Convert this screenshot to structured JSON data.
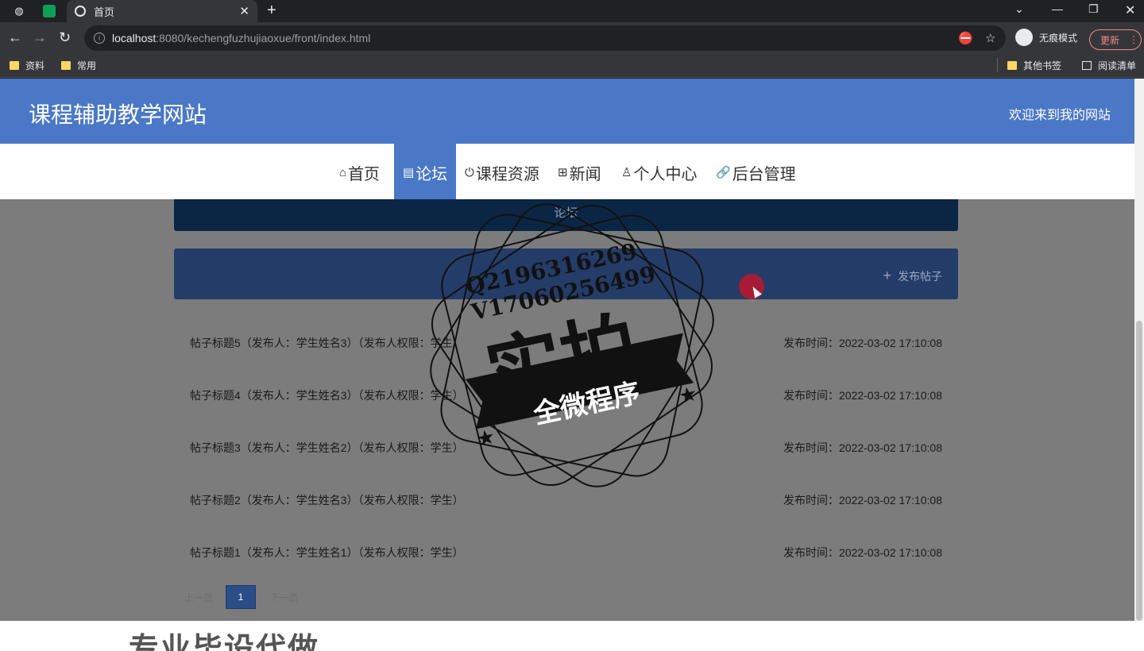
{
  "browser": {
    "tab_title": "首页",
    "url_host": "localhost",
    "url_rest": ":8080/kechengfuzhujiaoxue/front/index.html",
    "incognito_label": "无痕模式",
    "update_label": "更新",
    "bookmarks": [
      {
        "label": "资料"
      },
      {
        "label": "常用"
      }
    ],
    "other_bookmarks": "其他书签",
    "reading_list": "阅读清单"
  },
  "site": {
    "title": "课程辅助教学网站",
    "welcome": "欢迎来到我的网站",
    "nav": [
      {
        "icon": "⌂",
        "label": "首页"
      },
      {
        "icon": "▤",
        "label": "论坛"
      },
      {
        "icon": "⏻",
        "label": "课程资源"
      },
      {
        "icon": "⊞",
        "label": "新闻"
      },
      {
        "icon": "♙",
        "label": "个人中心"
      },
      {
        "icon": "🔗",
        "label": "后台管理"
      }
    ],
    "breadcrumb": "论坛",
    "post_button": "发布帖子",
    "posts": [
      {
        "title": "帖子标题5（发布人：学生姓名3）（发布人权限：学生）",
        "time": "发布时间：2022-03-02 17:10:08"
      },
      {
        "title": "帖子标题4（发布人：学生姓名3）（发布人权限：学生）",
        "time": "发布时间：2022-03-02 17:10:08"
      },
      {
        "title": "帖子标题3（发布人：学生姓名2）（发布人权限：学生）",
        "time": "发布时间：2022-03-02 17:10:08"
      },
      {
        "title": "帖子标题2（发布人：学生姓名3）（发布人权限：学生）",
        "time": "发布时间：2022-03-02 17:10:08"
      },
      {
        "title": "帖子标题1（发布人：学生姓名1）（发布人权限：学生）",
        "time": "发布时间：2022-03-02 17:10:08"
      }
    ],
    "pager": {
      "prev": "上一页",
      "current": "1",
      "next": "下一页"
    }
  },
  "watermark": {
    "line1": "Q2196316269",
    "line2": "V17060256499",
    "main": "实拍",
    "banner": "全微程序"
  },
  "overlay_text": "专业毕设代做"
}
